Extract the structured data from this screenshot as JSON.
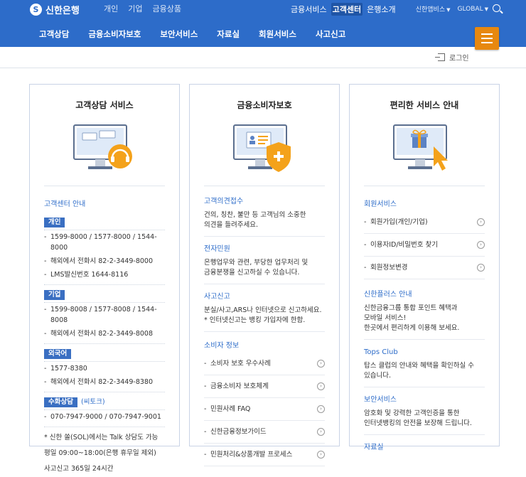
{
  "brand": {
    "name": "신한은행"
  },
  "segment_nav": [
    "개인",
    "기업",
    "금융상품"
  ],
  "util_nav": {
    "items": [
      "금융서비스",
      "고객센터",
      "은행소개"
    ],
    "active": "고객센터"
  },
  "right_nav": {
    "family": "신한앱비스",
    "global": "GLOBAL"
  },
  "main_nav": [
    "고객상담",
    "금융소비자보호",
    "보안서비스",
    "자료실",
    "회원서비스",
    "사고신고"
  ],
  "login": {
    "label": "로그인"
  },
  "card1": {
    "title": "고객상담 서비스",
    "section_title": "고객센터 안내",
    "groups": [
      {
        "tag": "개인",
        "note": "",
        "lines": [
          "1599-8000 / 1577-8000 / 1544-8000",
          "해외에서 전화시 82-2-3449-8000",
          "LMS발신번호 1644-8116"
        ]
      },
      {
        "tag": "기업",
        "note": "",
        "lines": [
          "1599-8008 / 1577-8008 / 1544-8008",
          "해외에서 전화시 82-2-3449-8008"
        ]
      },
      {
        "tag": "외국어",
        "note": "",
        "lines": [
          "1577-8380",
          "해외에서 전화시 82-2-3449-8380"
        ]
      },
      {
        "tag": "수화상담",
        "note": "(씨토크)",
        "lines": [
          "070-7947-9000 / 070-7947-9001"
        ]
      }
    ],
    "notes": [
      "* 신한 쏠(SOL)에서는 Talk 상담도 가능",
      "평일 09:00~18:00(은행 휴무일 제외)",
      "사고신고 365일 24시간"
    ]
  },
  "card2": {
    "title": "금융소비자보호",
    "blocks": [
      {
        "title": "고객의견접수",
        "desc": [
          "건의, 칭찬, 불만 등 고객님의 소중한",
          "의견을 들려주세요."
        ]
      },
      {
        "title": "전자민원",
        "desc": [
          "은행업무와 관련, 부당한 업무처리 및",
          "금융분쟁을 신고하실 수 있습니다."
        ]
      },
      {
        "title": "사고신고",
        "desc": [
          "분실/사고,ARS나 인터넷으로 신고하세요.",
          "* 인터넷신고는 뱅킹 가입자에 한함."
        ]
      }
    ],
    "sub_title": "소비자 정보",
    "items": [
      "소비자 보호 우수사례",
      "금융소비자 보호체계",
      "민원사례 FAQ",
      "신한금융정보가이드",
      "민원처리&상품개발 프로세스"
    ]
  },
  "card3": {
    "title": "편리한 서비스 안내",
    "section_title": "회원서비스",
    "items": [
      "회원가입(개인/기업)",
      "이용자ID/비밀번호 찾기",
      "회원정보변경"
    ],
    "blocks": [
      {
        "title": "신한플러스 안내",
        "desc": [
          "신한금융그룹 통합 포인트 혜택과",
          "모바일 서비스!",
          "한곳에서 편리하게 이용해 보세요."
        ]
      },
      {
        "title": "Tops Club",
        "desc": [
          "탑스 클럽의 안내와 혜택을 확인하실 수",
          "있습니다."
        ]
      },
      {
        "title": "보안서비스",
        "desc": [
          "암호화 및 강력한 고객인증을 통한",
          "인터넷뱅킹의 안전을 보장해 드립니다."
        ]
      }
    ],
    "last_title": "자료실"
  },
  "colors": {
    "header_blue": "#2d6cc9",
    "accent_orange": "#e7880f"
  }
}
